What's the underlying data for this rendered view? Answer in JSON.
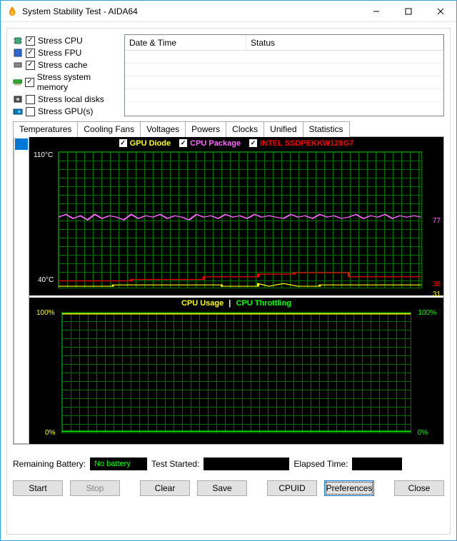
{
  "window": {
    "title": "System Stability Test - AIDA64"
  },
  "stress": [
    {
      "label": "Stress CPU",
      "checked": true,
      "icon": "cpu"
    },
    {
      "label": "Stress FPU",
      "checked": true,
      "icon": "fpu"
    },
    {
      "label": "Stress cache",
      "checked": true,
      "icon": "cache"
    },
    {
      "label": "Stress system memory",
      "checked": true,
      "icon": "ram"
    },
    {
      "label": "Stress local disks",
      "checked": false,
      "icon": "disk"
    },
    {
      "label": "Stress GPU(s)",
      "checked": false,
      "icon": "gpu"
    }
  ],
  "log_headers": {
    "datetime": "Date & Time",
    "status": "Status"
  },
  "tabs": {
    "list": [
      "Temperatures",
      "Cooling Fans",
      "Voltages",
      "Powers",
      "Clocks",
      "Unified",
      "Statistics"
    ],
    "active": 0
  },
  "chart1": {
    "legend": [
      {
        "label": "GPU Diode",
        "color": "#ffff00",
        "checked": true
      },
      {
        "label": "CPU Package",
        "color": "#ff66ff",
        "checked": true
      },
      {
        "label": "INTEL SSDPEKKW128G7",
        "color": "#ff0000",
        "checked": true
      }
    ],
    "y_top": "110°C",
    "y_bot": "40°C",
    "readouts": [
      {
        "value": "77",
        "color": "#ff66ff",
        "pos": 0.47
      },
      {
        "value": "39",
        "color": "#ff0000",
        "pos": 0.93
      },
      {
        "value": "31",
        "color": "#ffff00",
        "pos": 1.0
      }
    ]
  },
  "chart2": {
    "title_a": "CPU Usage",
    "title_sep": "|",
    "title_b": "CPU Throttling",
    "left_top": "100%",
    "left_bot": "0%",
    "right_top": "100%",
    "right_bot": "0%"
  },
  "bottom": {
    "battery_label": "Remaining Battery:",
    "battery_value": "No battery",
    "started_label": "Test Started:",
    "started_value": "",
    "elapsed_label": "Elapsed Time:",
    "elapsed_value": ""
  },
  "buttons": {
    "start": "Start",
    "stop": "Stop",
    "clear": "Clear",
    "save": "Save",
    "cpuid": "CPUID",
    "prefs": "Preferences",
    "close": "Close"
  },
  "chart_data": [
    {
      "type": "line",
      "title": "Temperatures",
      "ylabel": "°C",
      "ylim": [
        40,
        110
      ],
      "x": "time (relative, unlabeled)",
      "series": [
        {
          "name": "CPU Package",
          "current": 77,
          "approx_range": [
            72,
            82
          ]
        },
        {
          "name": "INTEL SSDPEKKW128G7",
          "current": 39,
          "approx_range": [
            38,
            41
          ]
        },
        {
          "name": "GPU Diode",
          "current": 31,
          "approx_range": [
            30,
            33
          ]
        }
      ]
    },
    {
      "type": "line",
      "title": "CPU Usage / CPU Throttling",
      "ylabel": "%",
      "ylim": [
        0,
        100
      ],
      "series": [
        {
          "name": "CPU Usage",
          "current": 100,
          "approx_constant": 100
        },
        {
          "name": "CPU Throttling",
          "current": 0,
          "approx_constant": 0
        }
      ]
    }
  ]
}
